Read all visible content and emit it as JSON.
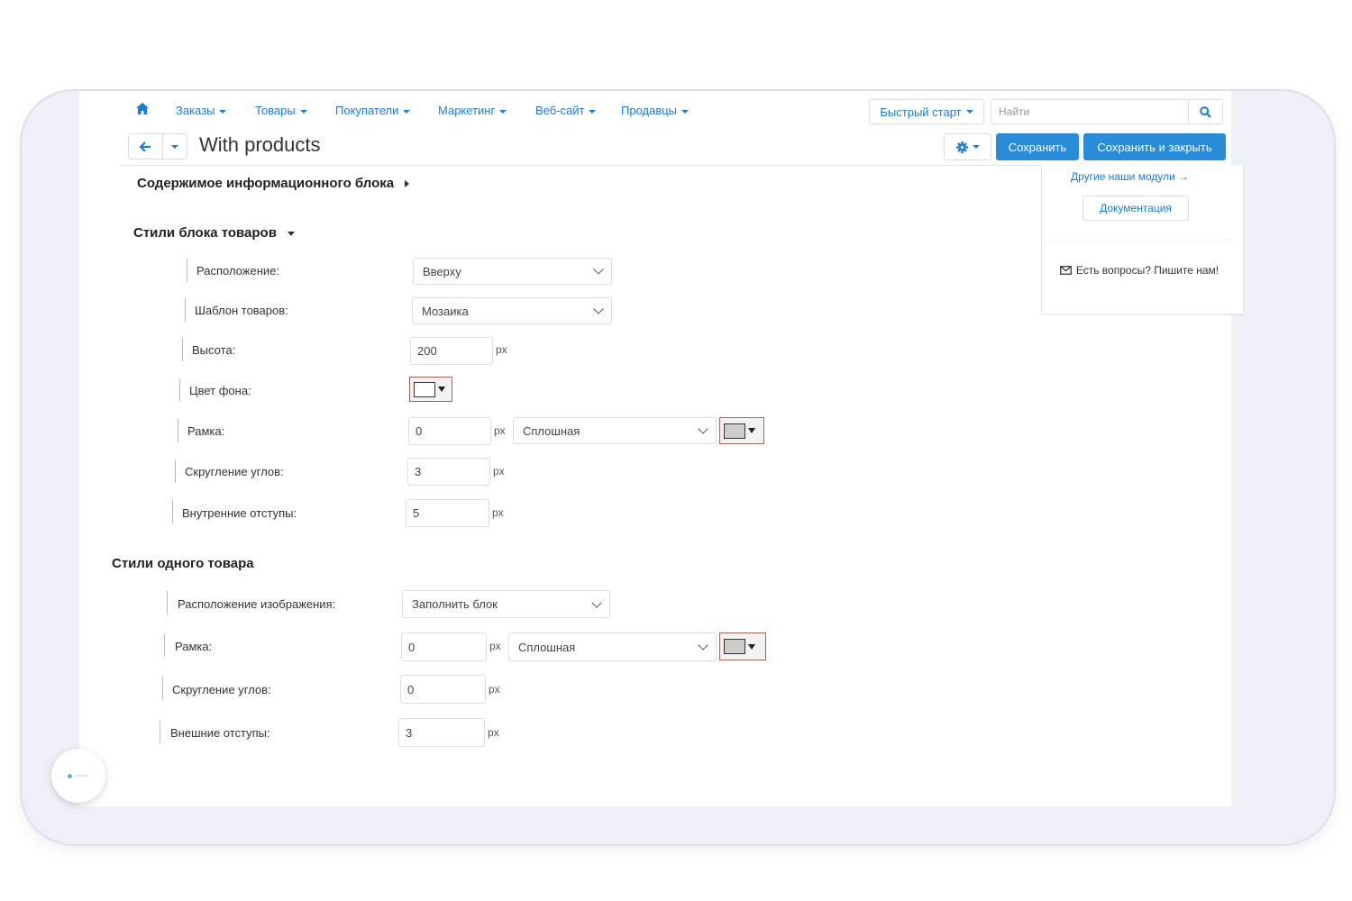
{
  "nav": {
    "items": [
      {
        "label": "Заказы"
      },
      {
        "label": "Товары"
      },
      {
        "label": "Покупатели"
      },
      {
        "label": "Маркетинг"
      },
      {
        "label": "Веб-сайт"
      },
      {
        "label": "Продавцы"
      }
    ],
    "quick_start": "Быстрый старт",
    "search_placeholder": "Найти"
  },
  "header": {
    "title": "With products",
    "save": "Сохранить",
    "save_close": "Сохранить и закрыть"
  },
  "sidebar": {
    "other_modules": "Другие наши модули →",
    "docs": "Документация",
    "contact": "Есть вопросы? Пишите нам!"
  },
  "content_section": {
    "title": "Содержимое информационного блока"
  },
  "block_styles": {
    "title": "Стили блока товаров",
    "position_label": "Расположение:",
    "position_value": "Вверху",
    "template_label": "Шаблон товаров:",
    "template_value": "Мозаика",
    "height_label": "Высота:",
    "height_value": "200",
    "bg_label": "Цвет фона:",
    "bg_color": "#ffffff",
    "border_label": "Рамка:",
    "border_width": "0",
    "border_style": "Сплошная",
    "border_color": "#cccccc",
    "radius_label": "Скругление углов:",
    "radius_value": "3",
    "padding_label": "Внутренние отступы:",
    "padding_value": "5"
  },
  "item_styles": {
    "title": "Стили одного товара",
    "image_label": "Расположение изображения:",
    "image_value": "Заполнить блок",
    "border_label": "Рамка:",
    "border_width": "0",
    "border_style": "Сплошная",
    "border_color": "#cccccc",
    "radius_label": "Скругление углов:",
    "radius_value": "0",
    "margin_label": "Внешние отступы:",
    "margin_value": "3"
  },
  "units": {
    "px": "px"
  },
  "colors": {
    "accent": "#1c7bd4",
    "primary_button": "#2a8bd8"
  }
}
